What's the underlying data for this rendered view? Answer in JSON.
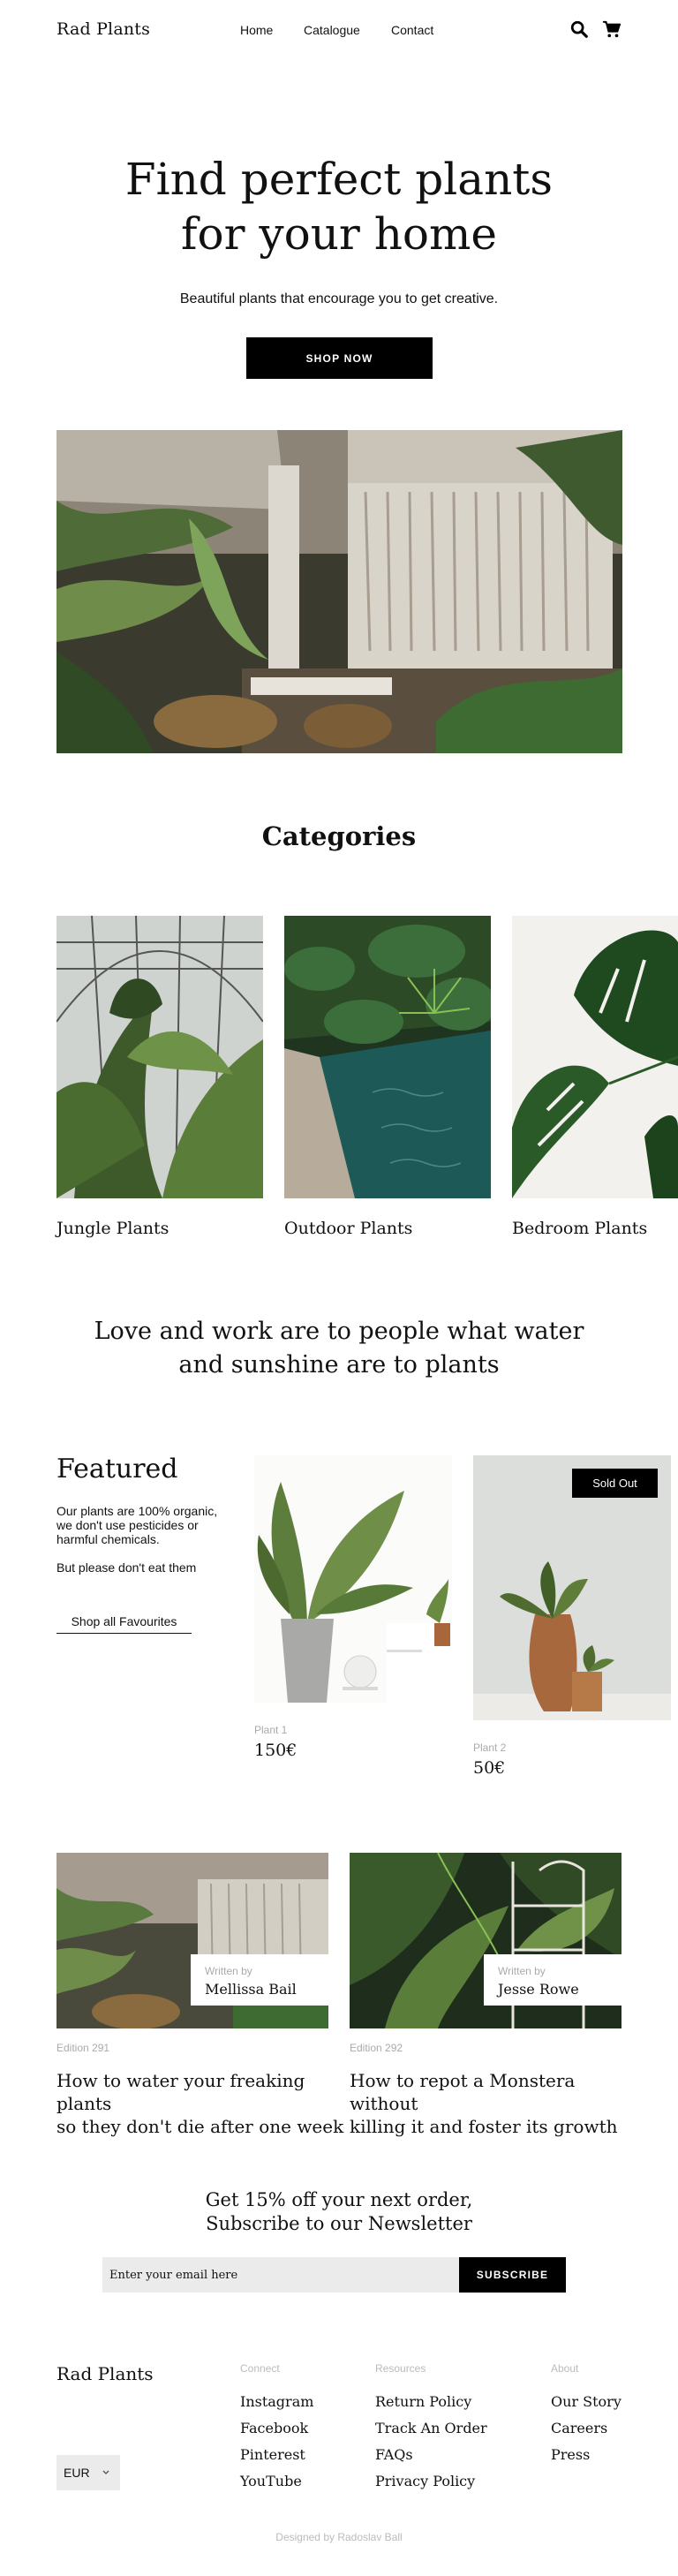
{
  "header": {
    "logo": "Rad Plants",
    "nav": [
      "Home",
      "Catalogue",
      "Contact"
    ],
    "icons": [
      "search-icon",
      "cart-icon"
    ]
  },
  "hero": {
    "title_line1": "Find perfect plants",
    "title_line2": "for your home",
    "subtitle": "Beautiful plants that encourage you to get creative.",
    "button": "SHOP NOW"
  },
  "categories": {
    "title": "Categories",
    "items": [
      {
        "label": "Jungle Plants"
      },
      {
        "label": "Outdoor Plants"
      },
      {
        "label": "Bedroom Plants"
      }
    ]
  },
  "quote": {
    "line1": "Love and work are to people what water",
    "line2": "and sunshine are to plants"
  },
  "featured": {
    "title": "Featured",
    "text1": "Our plants are 100% organic, we don't use pesticides or harmful chemicals.",
    "text2": "But please don't eat them",
    "link": "Shop all Favourites",
    "products": [
      {
        "name": "Plant 1",
        "price": "150€"
      },
      {
        "name": "Plant 2",
        "price": "50€",
        "badge": "Sold Out"
      }
    ]
  },
  "blog": {
    "posts": [
      {
        "written_by": "Written by",
        "author": "Mellissa Bail",
        "edition": "Edition 291",
        "title_line1": "How to water your freaking plants",
        "title_line2": "so they don't die after one week"
      },
      {
        "written_by": "Written by",
        "author": "Jesse Rowe",
        "edition": "Edition 292",
        "title_line1": "How to repot a Monstera without",
        "title_line2": "killing it and foster its growth"
      }
    ]
  },
  "newsletter": {
    "line1": "Get 15% off your next order,",
    "line2": "Subscribe to our Newsletter",
    "placeholder": "Enter your email here",
    "button": "SUBSCRIBE"
  },
  "footer": {
    "logo": "Rad Plants",
    "currency": "EUR",
    "columns": [
      {
        "heading": "Connect",
        "links": [
          "Instagram",
          "Facebook",
          "Pinterest",
          "YouTube"
        ]
      },
      {
        "heading": "Resources",
        "links": [
          "Return Policy",
          "Track An Order",
          "FAQs",
          "Privacy Policy"
        ]
      },
      {
        "heading": "About",
        "links": [
          "Our Story",
          "Careers",
          "Press"
        ]
      }
    ],
    "credit": "Designed by Radoslav Ball"
  }
}
